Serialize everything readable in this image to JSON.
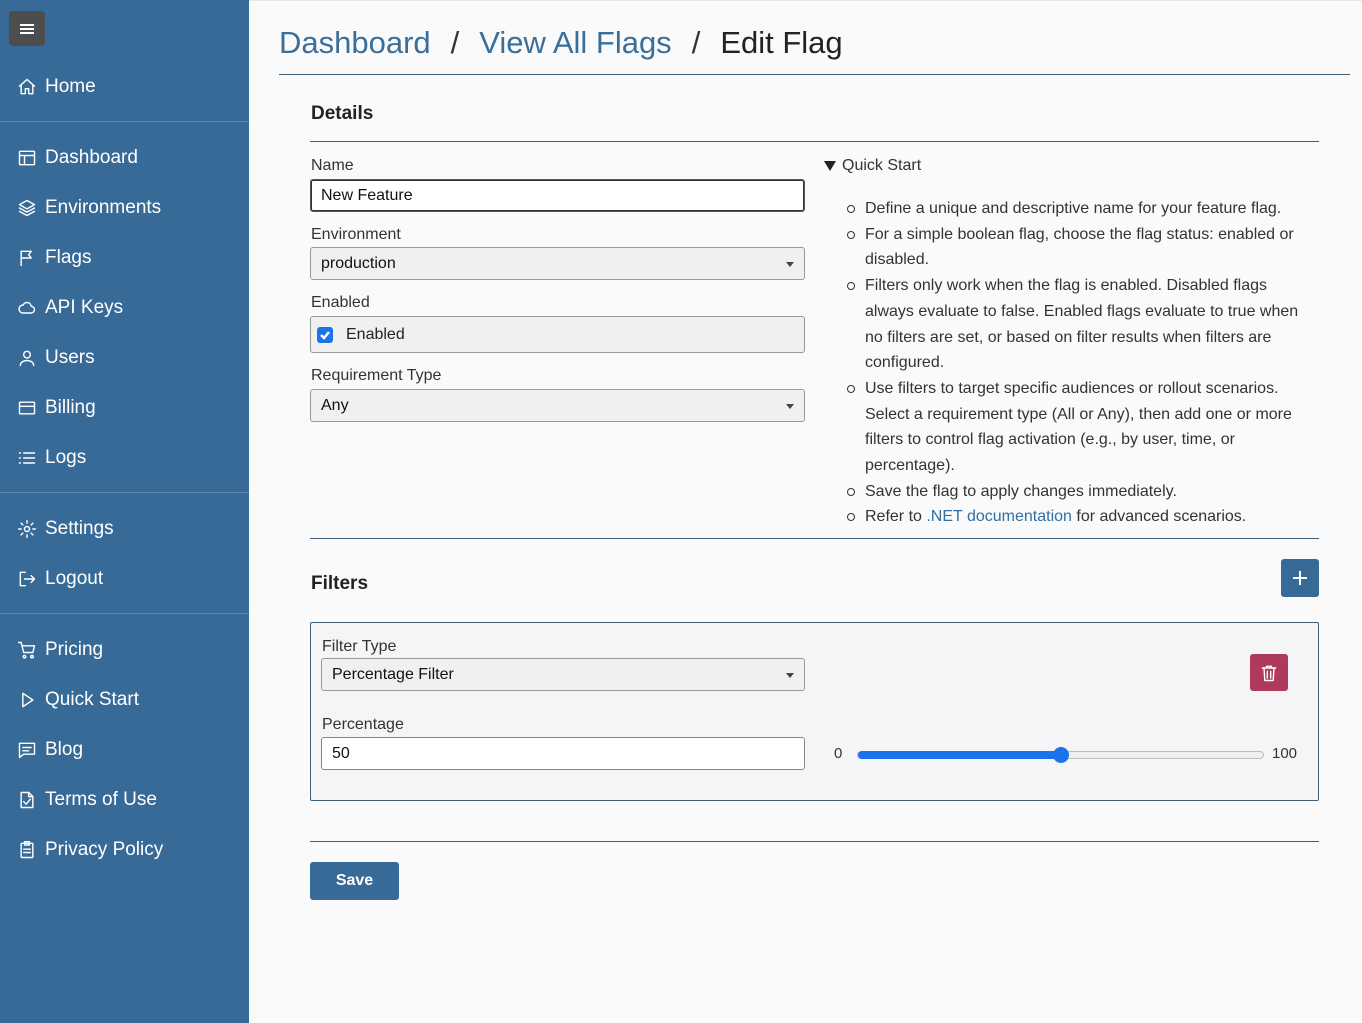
{
  "sidebar": {
    "groups": [
      [
        {
          "label": "Home",
          "icon": "home-icon"
        }
      ],
      [
        {
          "label": "Dashboard",
          "icon": "dashboard-icon"
        },
        {
          "label": "Environments",
          "icon": "layers-icon"
        },
        {
          "label": "Flags",
          "icon": "flag-icon"
        },
        {
          "label": "API Keys",
          "icon": "cloud-icon"
        },
        {
          "label": "Users",
          "icon": "user-icon"
        },
        {
          "label": "Billing",
          "icon": "credit-card-icon"
        },
        {
          "label": "Logs",
          "icon": "list-icon"
        }
      ],
      [
        {
          "label": "Settings",
          "icon": "gear-icon"
        },
        {
          "label": "Logout",
          "icon": "logout-icon"
        }
      ],
      [
        {
          "label": "Pricing",
          "icon": "cart-icon"
        },
        {
          "label": "Quick Start",
          "icon": "play-icon"
        },
        {
          "label": "Blog",
          "icon": "chat-icon"
        },
        {
          "label": "Terms of Use",
          "icon": "file-check-icon"
        },
        {
          "label": "Privacy Policy",
          "icon": "clipboard-icon"
        }
      ]
    ]
  },
  "breadcrumb": {
    "items": [
      "Dashboard",
      "View All Flags"
    ],
    "current": "Edit Flag",
    "separator": "/"
  },
  "details": {
    "title": "Details",
    "name_label": "Name",
    "name_value": "New Feature",
    "environment_label": "Environment",
    "environment_value": "production",
    "enabled_label": "Enabled",
    "enabled_checkbox_label": "Enabled",
    "enabled_checked": true,
    "requirement_label": "Requirement Type",
    "requirement_value": "Any"
  },
  "quick_start": {
    "summary": "Quick Start",
    "items": [
      "Define a unique and descriptive name for your feature flag.",
      "For a simple boolean flag, choose the flag status: enabled or disabled.",
      "Filters only work when the flag is enabled. Disabled flags always evaluate to false. Enabled flags evaluate to true when no filters are set, or based on filter results when filters are configured.",
      "Use filters to target specific audiences or rollout scenarios. Select a requirement type (All or Any), then add one or more filters to control flag activation (e.g., by user, time, or percentage).",
      "Save the flag to apply changes immediately."
    ],
    "last_prefix": "Refer to ",
    "last_link": ".NET documentation",
    "last_suffix": " for advanced scenarios."
  },
  "filters": {
    "title": "Filters",
    "filter_type_label": "Filter Type",
    "filter_type_value": "Percentage Filter",
    "percentage_label": "Percentage",
    "percentage_value": "50",
    "slider_min": "0",
    "slider_max": "100",
    "slider_fraction": 0.5
  },
  "save_label": "Save",
  "colors": {
    "sidebar": "#386a98",
    "link": "#3b6f9a",
    "accent": "#1a73e8",
    "danger": "#b03a5b"
  }
}
